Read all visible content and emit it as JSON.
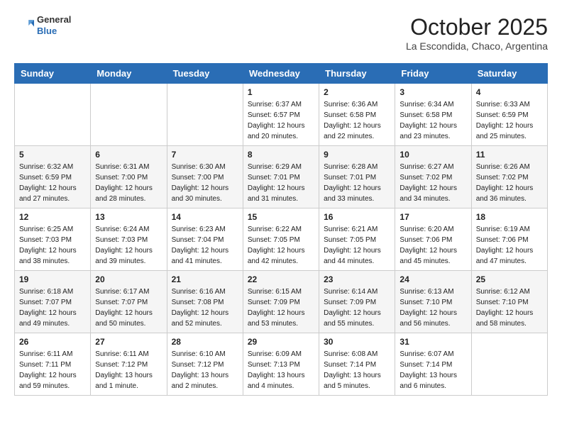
{
  "header": {
    "logo_general": "General",
    "logo_blue": "Blue",
    "month": "October 2025",
    "location": "La Escondida, Chaco, Argentina"
  },
  "weekdays": [
    "Sunday",
    "Monday",
    "Tuesday",
    "Wednesday",
    "Thursday",
    "Friday",
    "Saturday"
  ],
  "weeks": [
    [
      {
        "day": "",
        "info": ""
      },
      {
        "day": "",
        "info": ""
      },
      {
        "day": "",
        "info": ""
      },
      {
        "day": "1",
        "info": "Sunrise: 6:37 AM\nSunset: 6:57 PM\nDaylight: 12 hours\nand 20 minutes."
      },
      {
        "day": "2",
        "info": "Sunrise: 6:36 AM\nSunset: 6:58 PM\nDaylight: 12 hours\nand 22 minutes."
      },
      {
        "day": "3",
        "info": "Sunrise: 6:34 AM\nSunset: 6:58 PM\nDaylight: 12 hours\nand 23 minutes."
      },
      {
        "day": "4",
        "info": "Sunrise: 6:33 AM\nSunset: 6:59 PM\nDaylight: 12 hours\nand 25 minutes."
      }
    ],
    [
      {
        "day": "5",
        "info": "Sunrise: 6:32 AM\nSunset: 6:59 PM\nDaylight: 12 hours\nand 27 minutes."
      },
      {
        "day": "6",
        "info": "Sunrise: 6:31 AM\nSunset: 7:00 PM\nDaylight: 12 hours\nand 28 minutes."
      },
      {
        "day": "7",
        "info": "Sunrise: 6:30 AM\nSunset: 7:00 PM\nDaylight: 12 hours\nand 30 minutes."
      },
      {
        "day": "8",
        "info": "Sunrise: 6:29 AM\nSunset: 7:01 PM\nDaylight: 12 hours\nand 31 minutes."
      },
      {
        "day": "9",
        "info": "Sunrise: 6:28 AM\nSunset: 7:01 PM\nDaylight: 12 hours\nand 33 minutes."
      },
      {
        "day": "10",
        "info": "Sunrise: 6:27 AM\nSunset: 7:02 PM\nDaylight: 12 hours\nand 34 minutes."
      },
      {
        "day": "11",
        "info": "Sunrise: 6:26 AM\nSunset: 7:02 PM\nDaylight: 12 hours\nand 36 minutes."
      }
    ],
    [
      {
        "day": "12",
        "info": "Sunrise: 6:25 AM\nSunset: 7:03 PM\nDaylight: 12 hours\nand 38 minutes."
      },
      {
        "day": "13",
        "info": "Sunrise: 6:24 AM\nSunset: 7:03 PM\nDaylight: 12 hours\nand 39 minutes."
      },
      {
        "day": "14",
        "info": "Sunrise: 6:23 AM\nSunset: 7:04 PM\nDaylight: 12 hours\nand 41 minutes."
      },
      {
        "day": "15",
        "info": "Sunrise: 6:22 AM\nSunset: 7:05 PM\nDaylight: 12 hours\nand 42 minutes."
      },
      {
        "day": "16",
        "info": "Sunrise: 6:21 AM\nSunset: 7:05 PM\nDaylight: 12 hours\nand 44 minutes."
      },
      {
        "day": "17",
        "info": "Sunrise: 6:20 AM\nSunset: 7:06 PM\nDaylight: 12 hours\nand 45 minutes."
      },
      {
        "day": "18",
        "info": "Sunrise: 6:19 AM\nSunset: 7:06 PM\nDaylight: 12 hours\nand 47 minutes."
      }
    ],
    [
      {
        "day": "19",
        "info": "Sunrise: 6:18 AM\nSunset: 7:07 PM\nDaylight: 12 hours\nand 49 minutes."
      },
      {
        "day": "20",
        "info": "Sunrise: 6:17 AM\nSunset: 7:07 PM\nDaylight: 12 hours\nand 50 minutes."
      },
      {
        "day": "21",
        "info": "Sunrise: 6:16 AM\nSunset: 7:08 PM\nDaylight: 12 hours\nand 52 minutes."
      },
      {
        "day": "22",
        "info": "Sunrise: 6:15 AM\nSunset: 7:09 PM\nDaylight: 12 hours\nand 53 minutes."
      },
      {
        "day": "23",
        "info": "Sunrise: 6:14 AM\nSunset: 7:09 PM\nDaylight: 12 hours\nand 55 minutes."
      },
      {
        "day": "24",
        "info": "Sunrise: 6:13 AM\nSunset: 7:10 PM\nDaylight: 12 hours\nand 56 minutes."
      },
      {
        "day": "25",
        "info": "Sunrise: 6:12 AM\nSunset: 7:10 PM\nDaylight: 12 hours\nand 58 minutes."
      }
    ],
    [
      {
        "day": "26",
        "info": "Sunrise: 6:11 AM\nSunset: 7:11 PM\nDaylight: 12 hours\nand 59 minutes."
      },
      {
        "day": "27",
        "info": "Sunrise: 6:11 AM\nSunset: 7:12 PM\nDaylight: 13 hours\nand 1 minute."
      },
      {
        "day": "28",
        "info": "Sunrise: 6:10 AM\nSunset: 7:12 PM\nDaylight: 13 hours\nand 2 minutes."
      },
      {
        "day": "29",
        "info": "Sunrise: 6:09 AM\nSunset: 7:13 PM\nDaylight: 13 hours\nand 4 minutes."
      },
      {
        "day": "30",
        "info": "Sunrise: 6:08 AM\nSunset: 7:14 PM\nDaylight: 13 hours\nand 5 minutes."
      },
      {
        "day": "31",
        "info": "Sunrise: 6:07 AM\nSunset: 7:14 PM\nDaylight: 13 hours\nand 6 minutes."
      },
      {
        "day": "",
        "info": ""
      }
    ]
  ]
}
